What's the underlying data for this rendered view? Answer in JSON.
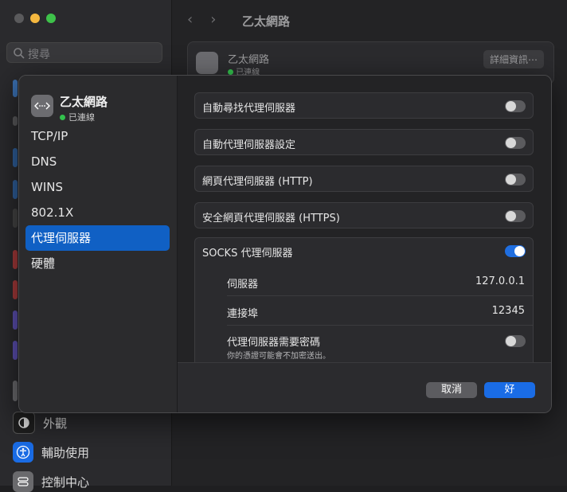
{
  "background": {
    "search_placeholder": "搜尋",
    "header_title": "乙太網路",
    "card": {
      "name": "乙太網路",
      "status": "已連線",
      "details_button": "詳細資訊⋯"
    },
    "bottom_items": [
      {
        "label": "外觀",
        "icon": "appearance-icon"
      },
      {
        "label": "輔助使用",
        "icon": "accessibility-icon"
      },
      {
        "label": "控制中心",
        "icon": "control-center-icon"
      }
    ]
  },
  "sheet": {
    "interface": {
      "name": "乙太網路",
      "status": "已連線",
      "icon": "ethernet-icon"
    },
    "nav": [
      "TCP/IP",
      "DNS",
      "WINS",
      "802.1X",
      "代理伺服器",
      "硬體"
    ],
    "selected_nav": "代理伺服器",
    "proxies": [
      {
        "label": "自動尋找代理伺服器",
        "enabled": false
      },
      {
        "label": "自動代理伺服器設定",
        "enabled": false
      },
      {
        "label": "網頁代理伺服器 (HTTP)",
        "enabled": false
      },
      {
        "label": "安全網頁代理伺服器 (HTTPS)",
        "enabled": false
      }
    ],
    "socks": {
      "label": "SOCKS 代理伺服器",
      "enabled": true,
      "server_label": "伺服器",
      "server_value": "127.0.0.1",
      "port_label": "連接埠",
      "port_value": "12345",
      "auth_label": "代理伺服器需要密碼",
      "auth_note": "你的憑證可能會不加密送出。",
      "auth_enabled": false
    },
    "buttons": {
      "cancel": "取消",
      "ok": "好"
    }
  },
  "colors": {
    "accent": "#1a6ce5",
    "status_green": "#33c24d"
  }
}
